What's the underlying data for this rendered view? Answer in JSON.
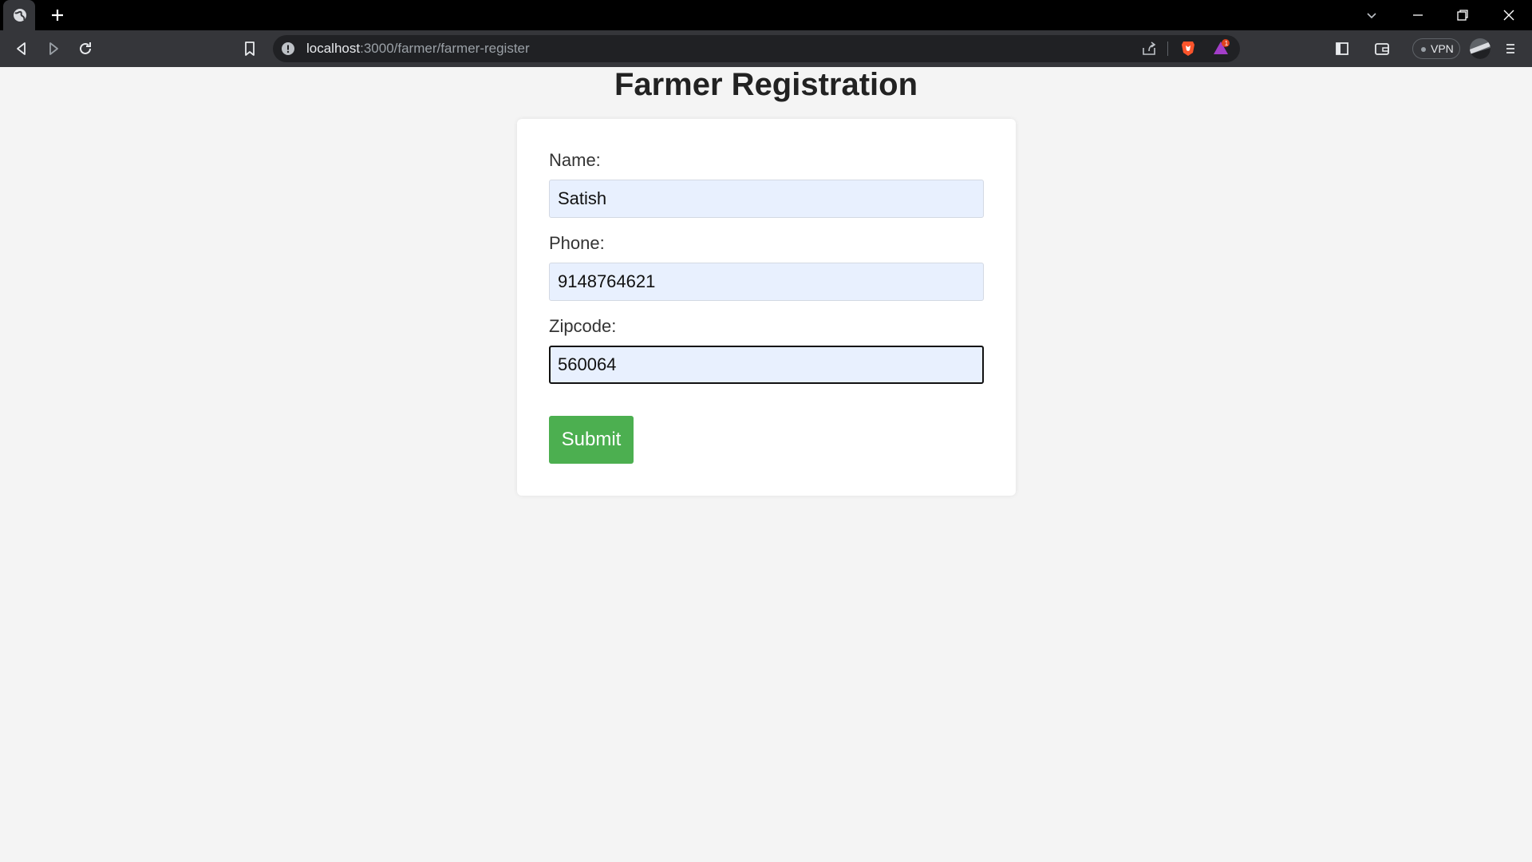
{
  "browser": {
    "url_host": "localhost",
    "url_path": ":3000/farmer/farmer-register",
    "vpn_label": "VPN",
    "rewards_badge": "1"
  },
  "page": {
    "title": "Farmer Registration"
  },
  "form": {
    "name_label": "Name:",
    "name_value": "Satish",
    "phone_label": "Phone:",
    "phone_value": "9148764621",
    "zipcode_label": "Zipcode:",
    "zipcode_value": "560064",
    "submit_label": "Submit"
  },
  "colors": {
    "submit_button": "#4caf50",
    "autofill_bg": "#e8f0fe",
    "page_bg": "#f4f4f4"
  }
}
